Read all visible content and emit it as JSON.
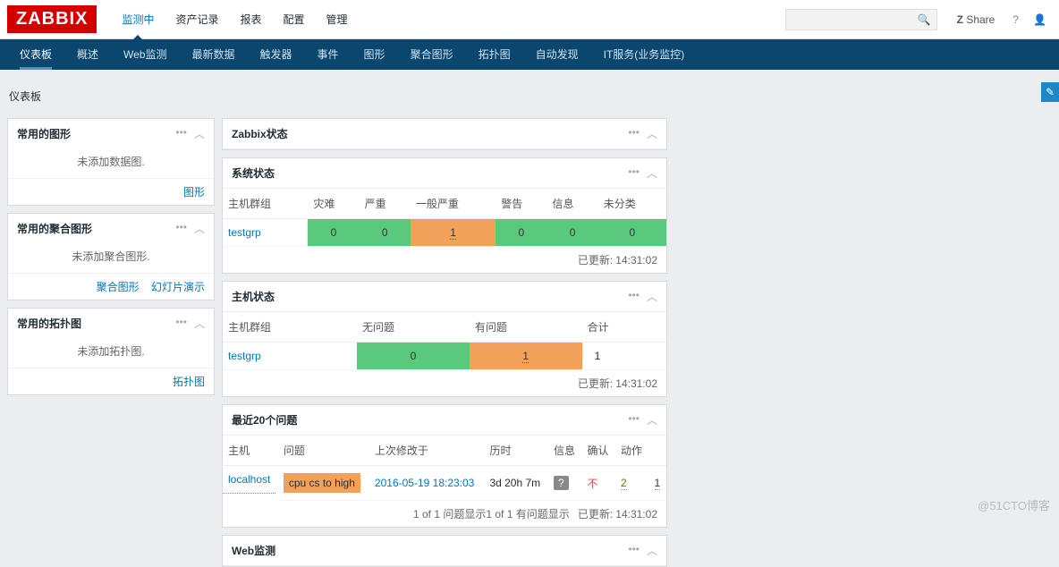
{
  "brand": "ZABBIX",
  "top_nav": {
    "items": [
      "监测中",
      "资产记录",
      "报表",
      "配置",
      "管理"
    ],
    "active": 0
  },
  "top_right": {
    "share": "Share",
    "help": "?",
    "z_badge": "Z"
  },
  "sub_nav": {
    "items": [
      "仪表板",
      "概述",
      "Web监测",
      "最新数据",
      "触发器",
      "事件",
      "图形",
      "聚合图形",
      "拓扑图",
      "自动发现",
      "IT服务(业务监控)"
    ],
    "active": 0
  },
  "page_title": "仪表板",
  "left_widgets": {
    "fav_graphs": {
      "title": "常用的图形",
      "empty": "未添加数据图.",
      "links": [
        "图形"
      ]
    },
    "fav_screens": {
      "title": "常用的聚合图形",
      "empty": "未添加聚合图形.",
      "links": [
        "聚合图形",
        "幻灯片演示"
      ]
    },
    "fav_maps": {
      "title": "常用的拓扑图",
      "empty": "未添加拓扑图.",
      "links": [
        "拓扑图"
      ]
    }
  },
  "zabbix_status": {
    "title": "Zabbix状态"
  },
  "system_status": {
    "title": "系统状态",
    "headers": [
      "主机群组",
      "灾难",
      "严重",
      "一般严重",
      "警告",
      "信息",
      "未分类"
    ],
    "rows": [
      {
        "group": "testgrp",
        "cells": [
          "0",
          "0",
          "1",
          "0",
          "0",
          "0"
        ],
        "highlight_idx": 2
      }
    ],
    "updated_label": "已更新:",
    "updated_time": "14:31:02"
  },
  "host_status": {
    "title": "主机状态",
    "headers": [
      "主机群组",
      "无问题",
      "有问题",
      "合计"
    ],
    "rows": [
      {
        "group": "testgrp",
        "ok": "0",
        "problem": "1",
        "total": "1"
      }
    ],
    "updated_label": "已更新:",
    "updated_time": "14:31:02"
  },
  "recent_problems": {
    "title": "最近20个问题",
    "headers": [
      "主机",
      "问题",
      "上次修改于",
      "历时",
      "信息",
      "确认",
      "动作",
      ""
    ],
    "rows": [
      {
        "host": "localhost",
        "problem": "cpu cs to high",
        "changed": "2016-05-19 18:23:03",
        "duration": "3d 20h 7m",
        "info": "?",
        "ack": "不",
        "actions": "2",
        "count": "1"
      }
    ],
    "footer": "1 of 1 问题显示1 of 1 有问题显示",
    "updated_label": "已更新:",
    "updated_time": "14:31:02"
  },
  "web_monitoring": {
    "title": "Web监测"
  },
  "watermark": "@51CTO博客"
}
